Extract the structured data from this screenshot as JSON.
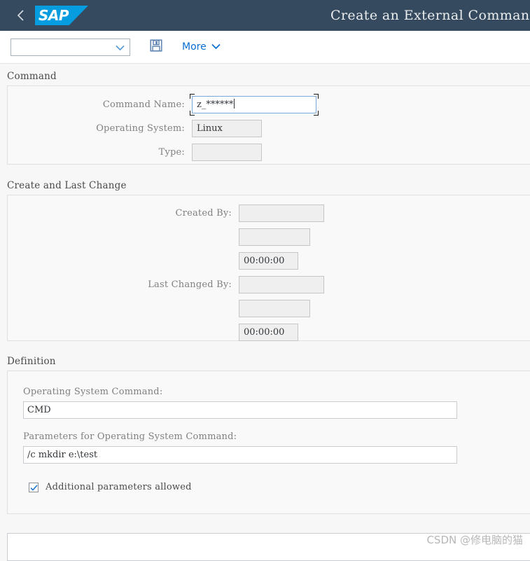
{
  "shell": {
    "title": "Create an External Command",
    "back_icon": "chevron-left-icon",
    "logo_text": "SAP",
    "logo_color": "#069DE0",
    "header_color": "#354A5F"
  },
  "toolbar": {
    "variant_value": "",
    "variant_placeholder": "",
    "save_icon": "floppy-disk-save-icon",
    "more_label": "More",
    "more_icon": "chevron-down-icon"
  },
  "sections": {
    "command": {
      "title": "Command",
      "fields": [
        {
          "label": "Command Name:",
          "value": "z_******",
          "focused": true,
          "editable": true
        },
        {
          "label": "Operating System:",
          "value": "Linux",
          "focused": false,
          "editable": false
        },
        {
          "label": "Type:",
          "value": "",
          "focused": false,
          "editable": false
        }
      ]
    },
    "create_last_change": {
      "title": "Create and Last Change",
      "created_by_label": "Created By:",
      "created_by_value": "",
      "created_date_value": "",
      "created_time_value": "00:00:00",
      "last_changed_by_label": "Last Changed By:",
      "last_changed_by_value": "",
      "last_changed_date_value": "",
      "last_changed_time_value": "00:00:00"
    },
    "definition": {
      "title": "Definition",
      "os_command_label": "Operating System Command:",
      "os_command_value": "CMD",
      "params_label": "Parameters for Operating System Command:",
      "params_value": "/c mkdir e:\\test",
      "checkbox_label": "Additional parameters allowed",
      "checkbox_checked": true
    }
  },
  "watermark": "CSDN @修电脑的猫",
  "colors": {
    "accent": "#0A6ED1",
    "page_background": "#F7F7F7",
    "panel_background": "#F9F9F9"
  }
}
